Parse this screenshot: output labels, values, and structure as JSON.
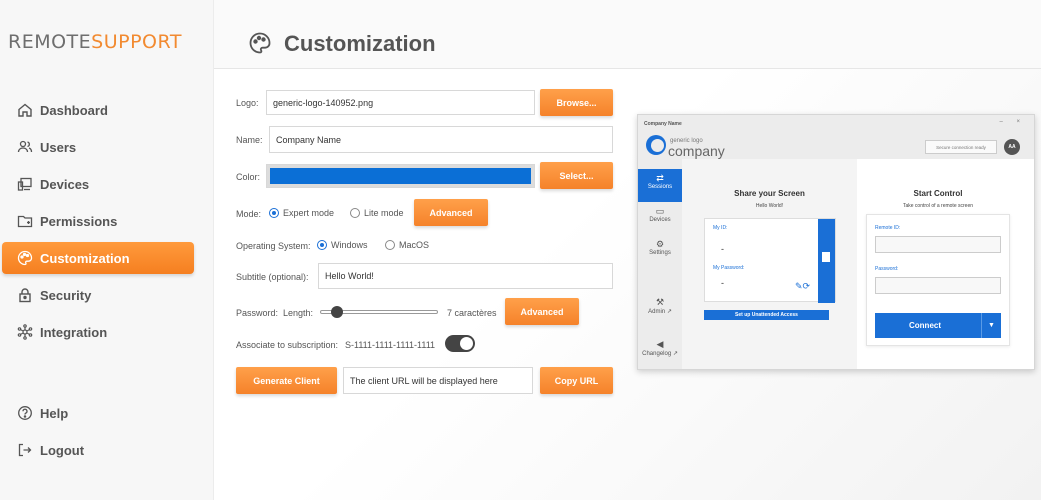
{
  "brand": {
    "part1": "REMOTE",
    "part2": "SUPPORT"
  },
  "sidebar": {
    "items": [
      {
        "label": "Dashboard",
        "icon": "home-icon"
      },
      {
        "label": "Users",
        "icon": "users-icon"
      },
      {
        "label": "Devices",
        "icon": "devices-icon"
      },
      {
        "label": "Permissions",
        "icon": "permissions-icon"
      },
      {
        "label": "Customization",
        "icon": "palette-icon",
        "active": true
      },
      {
        "label": "Security",
        "icon": "lock-icon"
      },
      {
        "label": "Integration",
        "icon": "integration-icon"
      }
    ],
    "bottom": [
      {
        "label": "Help",
        "icon": "help-icon"
      },
      {
        "label": "Logout",
        "icon": "logout-icon"
      }
    ]
  },
  "header": {
    "title": "Customization",
    "icon": "palette-icon"
  },
  "form": {
    "logo": {
      "label": "Logo:",
      "value": "generic-logo-140952.png",
      "button": "Browse..."
    },
    "name": {
      "label": "Name:",
      "value": "Company Name"
    },
    "color": {
      "label": "Color:",
      "value": "#0b6fd6",
      "button": "Select..."
    },
    "mode": {
      "label": "Mode:",
      "options": [
        "Expert mode",
        "Lite mode"
      ],
      "selected": "Expert mode",
      "button": "Advanced"
    },
    "os": {
      "label": "Operating System:",
      "options": [
        "Windows",
        "MacOS"
      ],
      "selected": "Windows"
    },
    "subtitle": {
      "label": "Subtitle (optional):",
      "value": "Hello World!"
    },
    "password": {
      "label": "Password:",
      "length_label": "Length:",
      "length_value": "7 caractères",
      "slider_fraction": 0.1,
      "button": "Advanced"
    },
    "subscription": {
      "label": "Associate to subscription:",
      "value": "S-1111-1111-1111-1111",
      "toggle_on": true
    },
    "generate": {
      "button": "Generate Client",
      "url_value": "The client URL will be displayed here",
      "copy_button": "Copy URL"
    }
  },
  "preview": {
    "title": "Company Name",
    "window_buttons": "–  ×",
    "logo_small": "generic logo",
    "logo_big": "company",
    "status": "Secure connection ready",
    "avatar": "AA",
    "sidebar": [
      {
        "label": "Sessions",
        "icon": "sessions-icon",
        "active": true
      },
      {
        "label": "Devices",
        "icon": "devices-icon"
      },
      {
        "label": "Settings",
        "icon": "gear-icon"
      },
      {
        "label": "Admin ↗",
        "icon": "tools-icon"
      },
      {
        "label": "Changelog ↗",
        "icon": "megaphone-icon"
      }
    ],
    "share": {
      "title": "Share your Screen",
      "subtitle": "Hello World!",
      "my_id_label": "My ID:",
      "my_id": "-",
      "password_label": "My Password:",
      "password": "-",
      "unattended": "Set up Unattended Access"
    },
    "control": {
      "title": "Start Control",
      "subtitle": "Take control of a remote screen",
      "remote_id_label": "Remote ID:",
      "password_label": "Password:",
      "connect": "Connect"
    }
  }
}
